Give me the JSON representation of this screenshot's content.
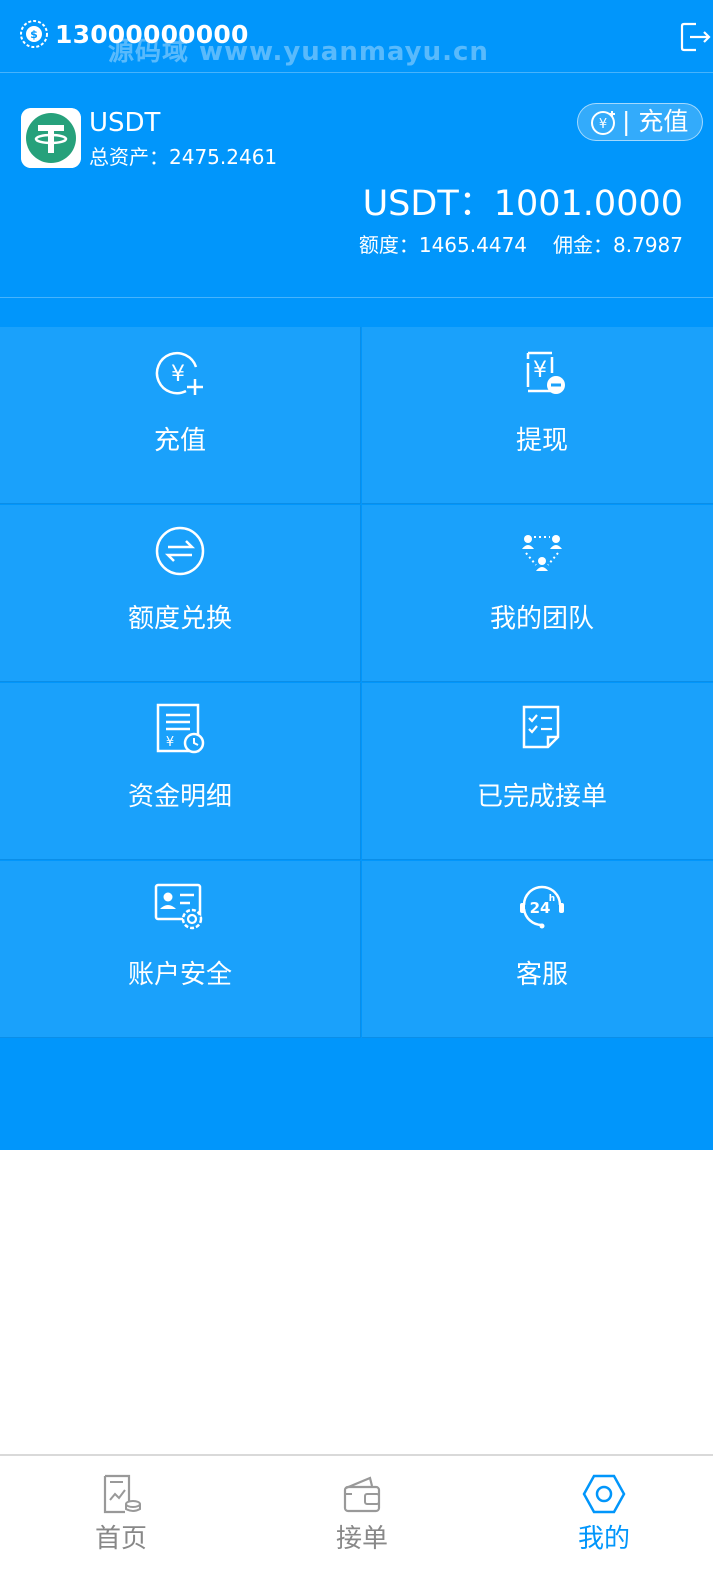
{
  "colors": {
    "primary": "#0196fb",
    "tile": "#1aa1fb",
    "nav_inactive": "#888888",
    "nav_active": "#0196fb"
  },
  "topbar": {
    "phone": "13000000000",
    "watermark": "源码域 www.yuanmayu.cn",
    "user_icon": "coin-user-icon",
    "logout_icon": "logout-icon"
  },
  "asset": {
    "coin_name": "USDT",
    "total_label": "总资产：",
    "total_value": "2475.2461",
    "recharge_label": "| 充值",
    "balance_line": "USDT：1001.0000",
    "quota_line": "额度：1465.4474",
    "commission_line": "佣金：8.7987"
  },
  "menu": [
    {
      "label": "充值",
      "icon": "yen-plus-icon"
    },
    {
      "label": "提现",
      "icon": "yen-minus-icon"
    },
    {
      "label": "额度兑换",
      "icon": "exchange-icon"
    },
    {
      "label": "我的团队",
      "icon": "team-icon"
    },
    {
      "label": "资金明细",
      "icon": "ledger-icon"
    },
    {
      "label": "已完成接单",
      "icon": "checklist-icon"
    },
    {
      "label": "账户安全",
      "icon": "id-gear-icon"
    },
    {
      "label": "客服",
      "icon": "support-24h-icon"
    }
  ],
  "nav": [
    {
      "label": "首页",
      "icon": "chart-coins-icon",
      "active": false
    },
    {
      "label": "接单",
      "icon": "wallet-icon",
      "active": false
    },
    {
      "label": "我的",
      "icon": "hexagon-icon",
      "active": true
    }
  ]
}
